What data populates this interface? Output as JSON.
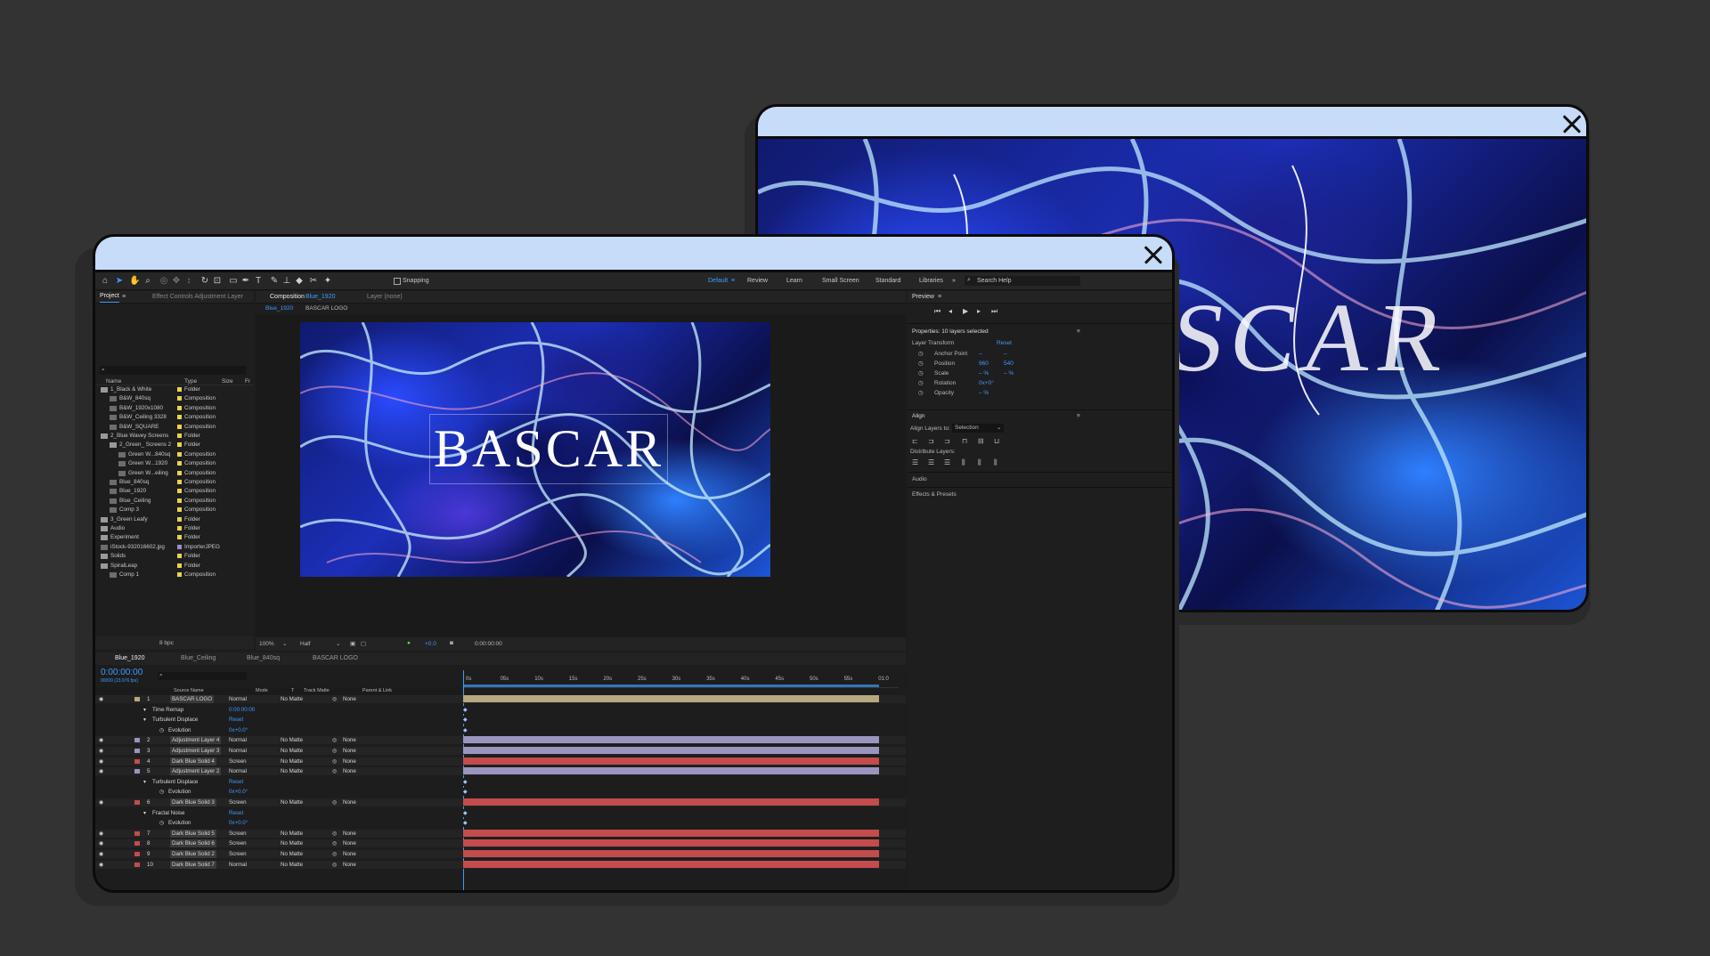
{
  "colors": {
    "titlebar": "#c7dcf9",
    "background": "#333333",
    "accent": "#3d9cff",
    "bar_purple": "#9a95be",
    "bar_red": "#c44c4c",
    "bar_tan": "#b8a880"
  },
  "menu": {
    "snapping": "Snapping",
    "workspaces": [
      "Default",
      "Review",
      "Learn",
      "Small Screen",
      "Standard",
      "Libraries"
    ],
    "search": "Search Help"
  },
  "project": {
    "tab": "Project",
    "effect_tab": "Effect Controls Adjustment Layer",
    "columns": {
      "name": "Name",
      "type": "Type",
      "size": "Size",
      "fr": "Fr"
    },
    "items": [
      {
        "name": "1_Black & White",
        "type": "Folder",
        "indent": 0,
        "color": "#e9d24f"
      },
      {
        "name": "B&W_840sq",
        "type": "Composition",
        "indent": 1,
        "color": "#e9d24f"
      },
      {
        "name": "B&W_1920x1080",
        "type": "Composition",
        "indent": 1,
        "color": "#e9d24f"
      },
      {
        "name": "B&W_Ceiling 3328",
        "type": "Composition",
        "indent": 1,
        "color": "#e9d24f"
      },
      {
        "name": "B&W_SQUARE",
        "type": "Composition",
        "indent": 1,
        "color": "#e9d24f"
      },
      {
        "name": "2_Blue Wavey Screens",
        "type": "Folder",
        "indent": 0,
        "color": "#e9d24f"
      },
      {
        "name": "2_Green_ Screens 2",
        "type": "Folder",
        "indent": 1,
        "color": "#e9d24f"
      },
      {
        "name": "Green W...840sq",
        "type": "Composition",
        "indent": 2,
        "color": "#e9d24f"
      },
      {
        "name": "Green W...1920",
        "type": "Composition",
        "indent": 2,
        "color": "#e9d24f"
      },
      {
        "name": "Green W...eiling",
        "type": "Composition",
        "indent": 2,
        "color": "#e9d24f"
      },
      {
        "name": "Blue_840sq",
        "type": "Composition",
        "indent": 1,
        "color": "#e9d24f"
      },
      {
        "name": "Blue_1920",
        "type": "Composition",
        "indent": 1,
        "color": "#e9d24f"
      },
      {
        "name": "Blue_Ceiling",
        "type": "Composition",
        "indent": 1,
        "color": "#e9d24f"
      },
      {
        "name": "Comp 3",
        "type": "Composition",
        "indent": 1,
        "color": "#e9d24f"
      },
      {
        "name": "3_Green Leafy",
        "type": "Folder",
        "indent": 0,
        "color": "#e9d24f"
      },
      {
        "name": "Audio",
        "type": "Folder",
        "indent": 0,
        "color": "#e9d24f"
      },
      {
        "name": "Experiment",
        "type": "Folder",
        "indent": 0,
        "color": "#e9d24f"
      },
      {
        "name": "iStock-932016602.jpg",
        "type": "ImporterJPEG",
        "indent": 0,
        "color": "#9b8ad6"
      },
      {
        "name": "Solids",
        "type": "Folder",
        "indent": 0,
        "color": "#e9d24f"
      },
      {
        "name": "SpiralLeap",
        "type": "Folder",
        "indent": 0,
        "color": "#e9d24f"
      },
      {
        "name": "Comp 1",
        "type": "Composition",
        "indent": 1,
        "color": "#e9d24f"
      }
    ],
    "bpc": "8 bpc"
  },
  "composition": {
    "tab": "Composition",
    "tab_name": "Blue_1920",
    "layer_tab": "Layer (none)",
    "crumbs": [
      "Blue_1920",
      "BASCAR LOGO"
    ],
    "title_text": "BASCAR",
    "zoom": "100%",
    "quality": "Half",
    "exposure": "+0.0",
    "timecode": "0:00:00:00"
  },
  "preview": {
    "title": "Preview"
  },
  "properties": {
    "title": "Properties: 10 layers selected",
    "section": "Layer Transform",
    "reset": "Reset",
    "rows": [
      {
        "label": "Anchor Point",
        "v1": "–",
        "v2": "–"
      },
      {
        "label": "Position",
        "v1": "960",
        "v2": "540"
      },
      {
        "label": "Scale",
        "v1": "– %",
        "v2": "– %"
      },
      {
        "label": "Rotation",
        "v1": "0x+0°",
        "v2": ""
      },
      {
        "label": "Opacity",
        "v1": "– %",
        "v2": ""
      }
    ]
  },
  "align": {
    "title": "Align",
    "align_to_label": "Align Layers to:",
    "align_to_value": "Selection",
    "distribute_label": "Distribute Layers:",
    "audio": "Audio",
    "effects": "Effects & Presets"
  },
  "timeline": {
    "tabs": [
      "Blue_1920",
      "Blue_Ceiling",
      "Blue_840sq",
      "BASCAR LOGO"
    ],
    "timecode": "0:00:00:00",
    "fps": "00000 (23.976 fps)",
    "cols": {
      "source": "Source Name",
      "mode": "Mode",
      "t": "T",
      "matte": "Track Matte",
      "parent": "Parent & Link"
    },
    "ruler": [
      "0s",
      "05s",
      "10s",
      "15s",
      "20s",
      "25s",
      "30s",
      "35s",
      "40s",
      "45s",
      "50s",
      "55s",
      "01:0"
    ],
    "rows": [
      {
        "kind": "layer",
        "num": "1",
        "name": "BASCAR LOGO",
        "mode": "Normal",
        "matte": "No Matte",
        "parent": "None",
        "color": "#b8a880"
      },
      {
        "kind": "prop",
        "name": "Time Remap",
        "value": "0:00:00:00"
      },
      {
        "kind": "prop",
        "name": "Turbulent Displace",
        "value": "Reset"
      },
      {
        "kind": "sub",
        "name": "Evolution",
        "value": "0x+0.0°"
      },
      {
        "kind": "layer",
        "num": "2",
        "name": "Adjustment Layer 4",
        "mode": "Normal",
        "matte": "No Matte",
        "parent": "None",
        "color": "#9a95be"
      },
      {
        "kind": "layer",
        "num": "3",
        "name": "Adjustment Layer 3",
        "mode": "Normal",
        "matte": "No Matte",
        "parent": "None",
        "color": "#9a95be"
      },
      {
        "kind": "layer",
        "num": "4",
        "name": "Dark Blue Solid 4",
        "mode": "Screen",
        "matte": "No Matte",
        "parent": "None",
        "color": "#c44c4c"
      },
      {
        "kind": "layer",
        "num": "5",
        "name": "Adjustment Layer 2",
        "mode": "Normal",
        "matte": "No Matte",
        "parent": "None",
        "color": "#9a95be"
      },
      {
        "kind": "prop",
        "name": "Turbulent Displace",
        "value": "Reset"
      },
      {
        "kind": "sub",
        "name": "Evolution",
        "value": "0x+0.0°"
      },
      {
        "kind": "layer",
        "num": "6",
        "name": "Dark Blue Solid 3",
        "mode": "Screen",
        "matte": "No Matte",
        "parent": "None",
        "color": "#c44c4c"
      },
      {
        "kind": "prop",
        "name": "Fractal Noise",
        "value": "Reset"
      },
      {
        "kind": "sub",
        "name": "Evolution",
        "value": "0x+0.0°"
      },
      {
        "kind": "layer",
        "num": "7",
        "name": "Dark Blue Solid 5",
        "mode": "Screen",
        "matte": "No Matte",
        "parent": "None",
        "color": "#c44c4c"
      },
      {
        "kind": "layer",
        "num": "8",
        "name": "Dark Blue Solid 6",
        "mode": "Screen",
        "matte": "No Matte",
        "parent": "None",
        "color": "#c44c4c"
      },
      {
        "kind": "layer",
        "num": "9",
        "name": "Dark Blue Solid 2",
        "mode": "Screen",
        "matte": "No Matte",
        "parent": "None",
        "color": "#c44c4c"
      },
      {
        "kind": "layer",
        "num": "10",
        "name": "Dark Blue Solid 7",
        "mode": "Normal",
        "matte": "No Matte",
        "parent": "None",
        "color": "#c44c4c"
      }
    ]
  },
  "back_window": {
    "title_text": "BASCAR"
  }
}
